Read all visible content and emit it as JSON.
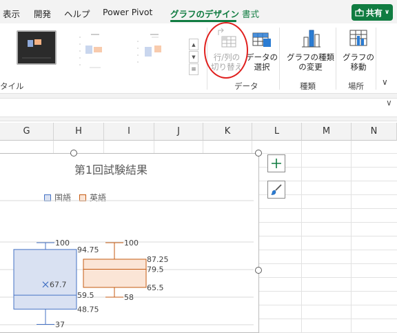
{
  "tabs": [
    {
      "label": "表示"
    },
    {
      "label": "開発"
    },
    {
      "label": "ヘルプ"
    },
    {
      "label": "Power Pivot"
    },
    {
      "label": "グラフのデザイン",
      "active": true
    },
    {
      "label": "書式"
    }
  ],
  "share": {
    "label": "共有"
  },
  "ribbon": {
    "style_group_label": "タイル",
    "data_group": {
      "label": "データ",
      "switch_row_col": {
        "line1": "行/列の",
        "line2": "切り替え",
        "enabled": false
      },
      "select_data": {
        "line1": "データの",
        "line2": "選択"
      }
    },
    "type_group": {
      "label": "種類",
      "change_type": {
        "line1": "グラフの種類",
        "line2": "の変更"
      }
    },
    "location_group": {
      "label": "場所",
      "move_chart": {
        "line1": "グラフの",
        "line2": "移動"
      }
    }
  },
  "columns": [
    "G",
    "H",
    "I",
    "J",
    "K",
    "L",
    "M",
    "N"
  ],
  "colors": {
    "accent": "#107c41",
    "kokugo_fill": "#d9e1f2",
    "kokugo_line": "#4472c4",
    "eigo_fill": "#fbe5d6",
    "eigo_line": "#c55a11",
    "annotation_circle": "#e0201e"
  },
  "chart_data": {
    "type": "box",
    "title": "第1回試験結果",
    "legend_position": "top",
    "series": [
      {
        "name": "国語",
        "max": 100,
        "q3": 94.75,
        "median": 59.5,
        "mean": 67.7,
        "q1": 48.75,
        "min": 37,
        "labels": {
          "max": "100",
          "q3": "94.75",
          "mean": "67.7",
          "median": "59.5",
          "q1": "48.75",
          "min": "37"
        }
      },
      {
        "name": "英語",
        "max": 100,
        "q3": 87.25,
        "median": 79.5,
        "q1": 65.5,
        "min": 58,
        "labels": {
          "max": "100",
          "q3": "87.25",
          "median": "79.5",
          "q1": "65.5",
          "min": "58"
        }
      }
    ]
  }
}
